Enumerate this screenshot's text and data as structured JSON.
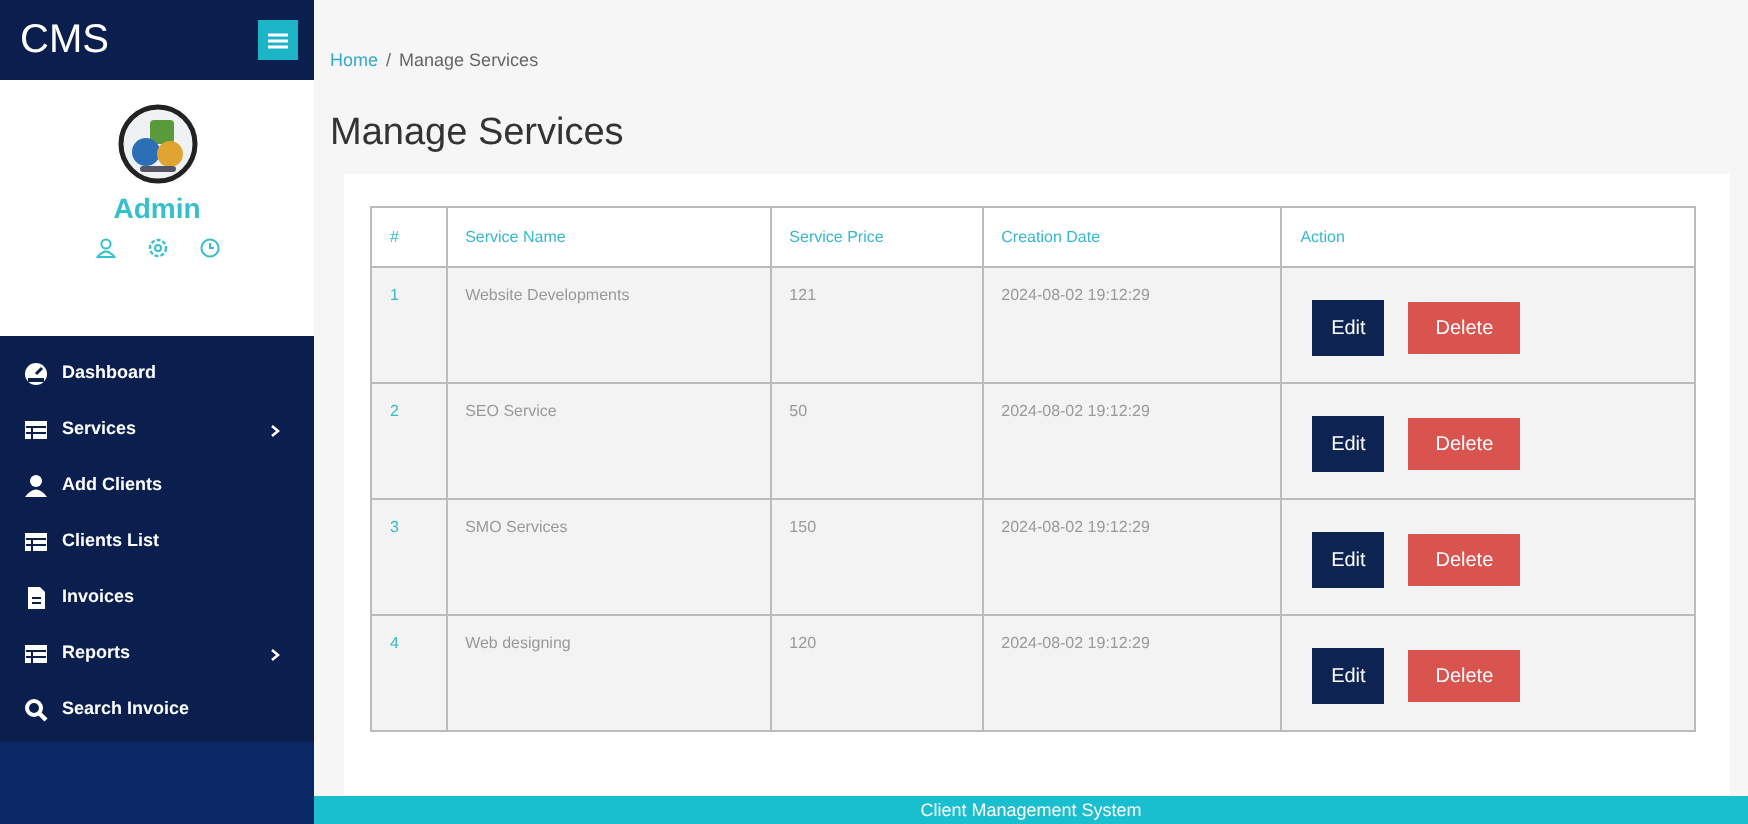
{
  "brand": "CMS",
  "profile": {
    "name": "Admin"
  },
  "sidebar": {
    "items": [
      {
        "label": "Dashboard",
        "kind": "dashboard",
        "submenu": false
      },
      {
        "label": "Services",
        "kind": "table",
        "submenu": true
      },
      {
        "label": "Add Clients",
        "kind": "user",
        "submenu": false
      },
      {
        "label": "Clients List",
        "kind": "table",
        "submenu": false
      },
      {
        "label": "Invoices",
        "kind": "file",
        "submenu": false
      },
      {
        "label": "Reports",
        "kind": "table",
        "submenu": true
      },
      {
        "label": "Search Invoice",
        "kind": "search",
        "submenu": false
      }
    ]
  },
  "breadcrumb": {
    "items": [
      "Home",
      "Manage Services"
    ],
    "separator": "/"
  },
  "page_title": "Manage Services",
  "table": {
    "columns": [
      "#",
      "Service Name",
      "Service Price",
      "Creation Date",
      "Action"
    ],
    "rows": [
      {
        "number": "1",
        "name": "Website Developments",
        "price": "121",
        "date": "2024-08-02 19:12:29",
        "actions": [
          "Edit",
          "Delete"
        ]
      },
      {
        "number": "2",
        "name": "SEO Service",
        "price": "50",
        "date": "2024-08-02 19:12:29",
        "actions": [
          "Edit",
          "Delete"
        ]
      },
      {
        "number": "3",
        "name": "SMO Services",
        "price": "150",
        "date": "2024-08-02 19:12:29",
        "actions": [
          "Edit",
          "Delete"
        ]
      },
      {
        "number": "4",
        "name": "Web designing",
        "price": "120",
        "date": "2024-08-02 19:12:29",
        "actions": [
          "Edit",
          "Delete"
        ]
      }
    ]
  },
  "footer": "Client Management System"
}
